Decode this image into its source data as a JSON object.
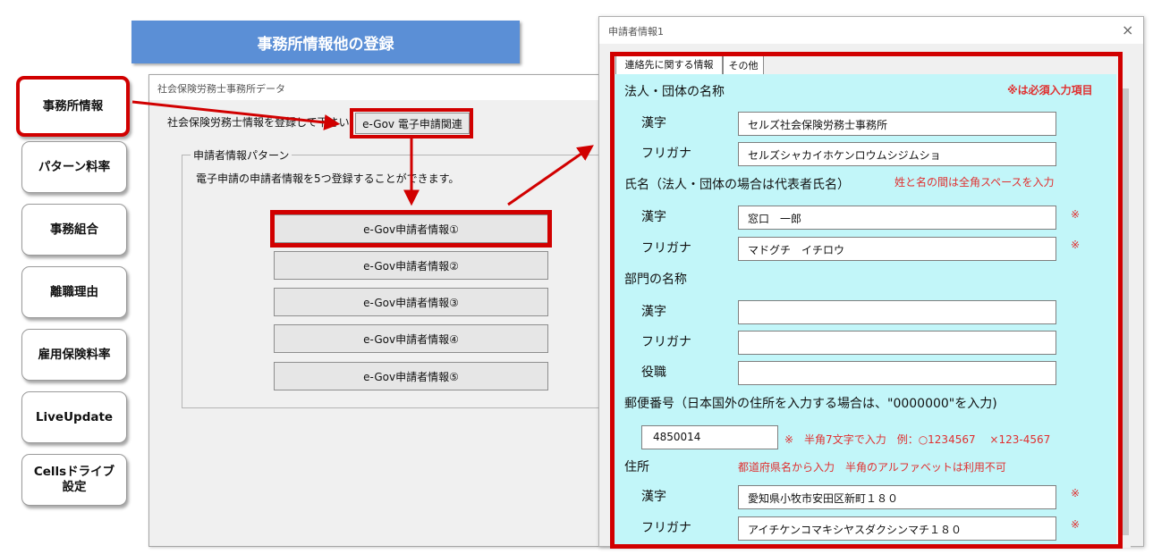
{
  "banner": {
    "title": "事務所情報他の登録"
  },
  "nav": [
    {
      "label": "事務所情報"
    },
    {
      "label": "パターン料率"
    },
    {
      "label": "事務組合"
    },
    {
      "label": "離職理由"
    },
    {
      "label": "雇用保険料率"
    },
    {
      "label": "LiveUpdate"
    },
    {
      "label": "Cellsドライブ\n設定"
    }
  ],
  "back_dialog": {
    "title": "社会保険労務士事務所データ",
    "register_label": "社会保険労務士情報を登録して下さい。",
    "egov_related_button": "e-Gov 電子申請関連",
    "group_legend": "申請者情報パターン",
    "group_desc": "電子申請の申請者情報を5つ登録することができます。",
    "buttons": [
      "e-Gov申請者情報①",
      "e-Gov申請者情報②",
      "e-Gov申請者情報③",
      "e-Gov申請者情報④",
      "e-Gov申請者情報⑤"
    ]
  },
  "front_dialog": {
    "title": "申請者情報1",
    "close_icon": "×",
    "tabs": [
      "連絡先に関する情報",
      "その他"
    ],
    "required_note": "※は必須入力項目",
    "required_mark": "※",
    "corp": {
      "heading": "法人・団体の名称",
      "kanji_label": "漢字",
      "kanji_value": "セルズ社会保険労務士事務所",
      "kana_label": "フリガナ",
      "kana_value": "セルズシャカイホケンロウムシジムショ"
    },
    "name": {
      "heading": "氏名（法人・団体の場合は代表者氏名）",
      "note": "姓と名の間は全角スペースを入力",
      "kanji_label": "漢字",
      "kanji_value": "窓口　一郎",
      "kana_label": "フリガナ",
      "kana_value": "マドグチ　イチロウ"
    },
    "dept": {
      "heading": "部門の名称",
      "kanji_label": "漢字",
      "kanji_value": "",
      "kana_label": "フリガナ",
      "kana_value": "",
      "title_label": "役職",
      "title_value": ""
    },
    "postal": {
      "heading": "郵便番号（日本国外の住所を入力する場合は、\"0000000\"を入力)",
      "value": "4850014",
      "note": "※　半角7文字で入力　例：○1234567　 ×123-4567"
    },
    "address": {
      "heading": "住所",
      "note": "都道府県名から入力　半角のアルファベットは利用不可",
      "kanji_label": "漢字",
      "kanji_value": "愛知県小牧市安田区新町１８０",
      "kana_label": "フリガナ",
      "kana_value": "アイチケンコマキシヤスダクシンマチ１８０"
    }
  },
  "colors": {
    "highlight": "#d10000",
    "banner": "#5b8fd6",
    "panel": "#c2f6f9"
  }
}
